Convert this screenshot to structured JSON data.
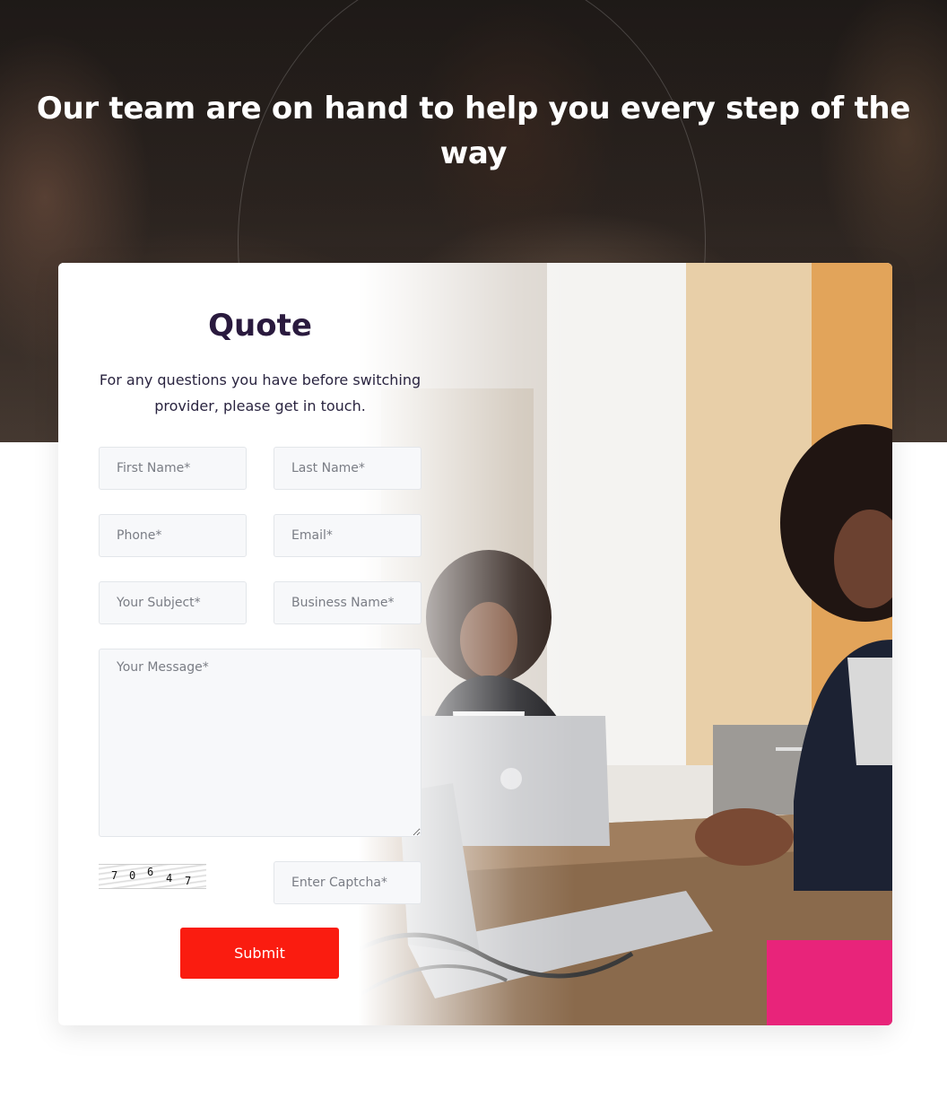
{
  "hero": {
    "title": "Our team are on hand to help you every step of the way"
  },
  "form": {
    "title": "Quote",
    "description": "For any questions you have before switching provider, please get in touch.",
    "placeholders": {
      "first_name": "First Name*",
      "last_name": "Last Name*",
      "phone": "Phone*",
      "email": "Email*",
      "subject": "Your Subject*",
      "business_name": "Business Name*",
      "message": "Your Message*",
      "captcha": "Enter Captcha*"
    },
    "captcha_digits": [
      "7",
      "0",
      "6",
      "4",
      "7"
    ],
    "submit_label": "Submit"
  },
  "colors": {
    "accent": "#fa1c10",
    "title": "#2a1a3e",
    "field_bg": "#f7f8fa"
  }
}
